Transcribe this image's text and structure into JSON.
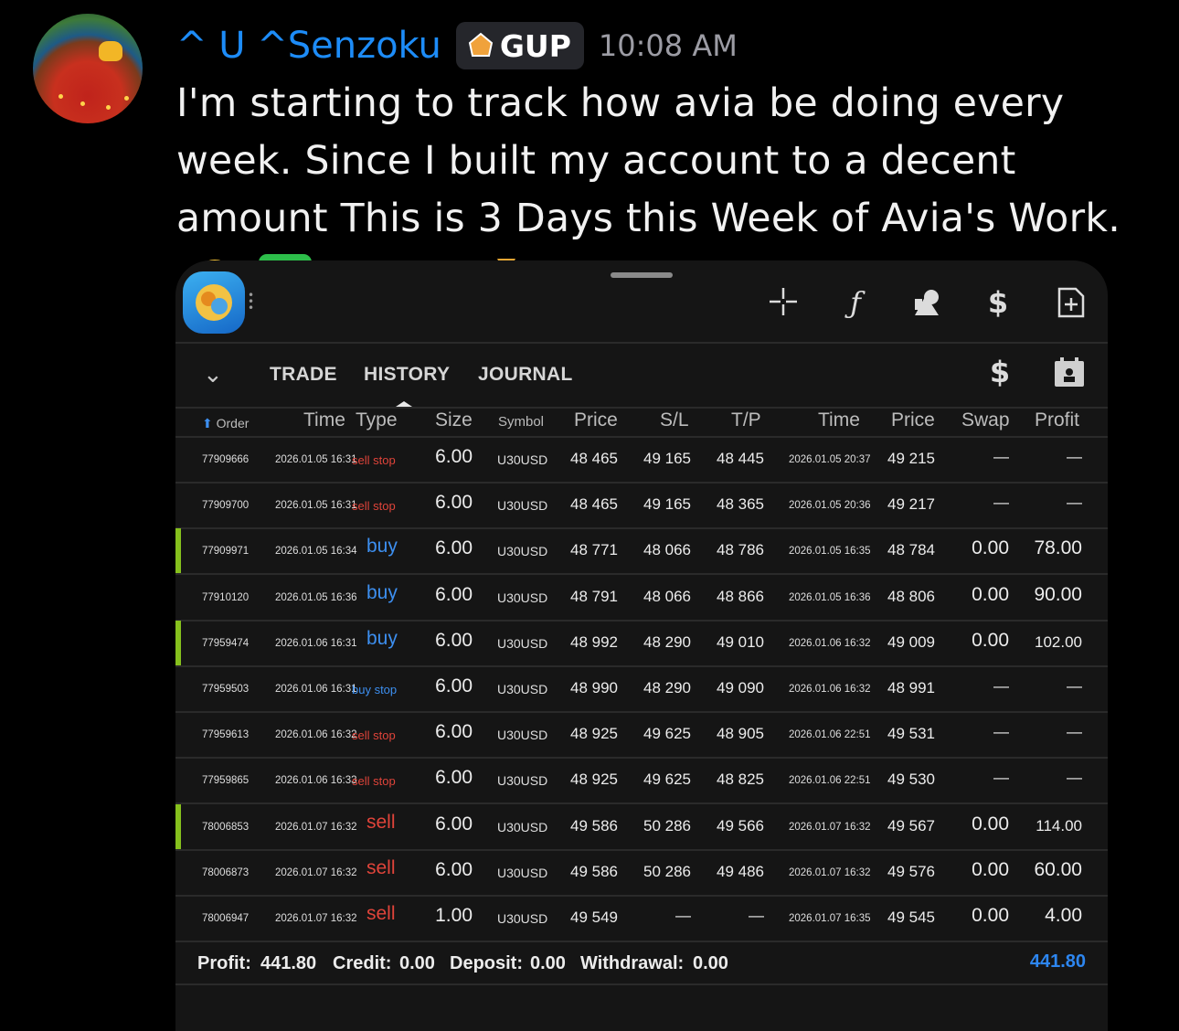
{
  "post": {
    "username": "^ U ^Senzoku",
    "tag": "GUP",
    "timestamp": "10:08 AM",
    "message": "I'm starting to track how avia be doing every week. Since I built my account to a decent amount This is 3 Days this Week of Avia's Work.",
    "emojis": [
      "saluting-face",
      "check-mark-button",
      "hundred-points",
      "dollar-banknote",
      "money-bag"
    ],
    "colors": {
      "username": "#1d8cf8",
      "timestamp": "#9c9ca4"
    }
  },
  "app": {
    "toolbar_icons": [
      "crosshair-icon",
      "function-icon",
      "objects-icon",
      "trade-dollar-icon",
      "new-document-icon"
    ],
    "tabs": [
      "TRADE",
      "HISTORY",
      "JOURNAL"
    ],
    "active_tab": "HISTORY",
    "columns": {
      "order": "Order",
      "time": "Time",
      "type": "Type",
      "size": "Size",
      "symbol": "Symbol",
      "price": "Price",
      "sl": "S/L",
      "tp": "T/P",
      "close_time": "Time",
      "close_price": "Price",
      "swap": "Swap",
      "profit": "Profit"
    },
    "rows": [
      {
        "order": "77909666",
        "time": "2026.01.05 16:31",
        "type": "sell stop",
        "size": "6.00",
        "symbol": "U30USD",
        "price": "48 465",
        "sl": "49 165",
        "tp": "48 445",
        "close_time": "2026.01.05 20:37",
        "close_price": "49 215",
        "swap": "—",
        "profit": "—",
        "marked": false
      },
      {
        "order": "77909700",
        "time": "2026.01.05 16:31",
        "type": "sell stop",
        "size": "6.00",
        "symbol": "U30USD",
        "price": "48 465",
        "sl": "49 165",
        "tp": "48 365",
        "close_time": "2026.01.05 20:36",
        "close_price": "49 217",
        "swap": "—",
        "profit": "—",
        "marked": false
      },
      {
        "order": "77909971",
        "time": "2026.01.05 16:34",
        "type": "buy",
        "size": "6.00",
        "symbol": "U30USD",
        "price": "48 771",
        "sl": "48 066",
        "tp": "48 786",
        "close_time": "2026.01.05 16:35",
        "close_price": "48 784",
        "swap": "0.00",
        "profit": "78.00",
        "marked": true
      },
      {
        "order": "77910120",
        "time": "2026.01.05 16:36",
        "type": "buy",
        "size": "6.00",
        "symbol": "U30USD",
        "price": "48 791",
        "sl": "48 066",
        "tp": "48 866",
        "close_time": "2026.01.05 16:36",
        "close_price": "48 806",
        "swap": "0.00",
        "profit": "90.00",
        "marked": false
      },
      {
        "order": "77959474",
        "time": "2026.01.06 16:31",
        "type": "buy",
        "size": "6.00",
        "symbol": "U30USD",
        "price": "48 992",
        "sl": "48 290",
        "tp": "49 010",
        "close_time": "2026.01.06 16:32",
        "close_price": "49 009",
        "swap": "0.00",
        "profit": "102.00",
        "marked": true
      },
      {
        "order": "77959503",
        "time": "2026.01.06 16:31",
        "type": "buy stop",
        "size": "6.00",
        "symbol": "U30USD",
        "price": "48 990",
        "sl": "48 290",
        "tp": "49 090",
        "close_time": "2026.01.06 16:32",
        "close_price": "48 991",
        "swap": "—",
        "profit": "—",
        "marked": false
      },
      {
        "order": "77959613",
        "time": "2026.01.06 16:32",
        "type": "sell stop",
        "size": "6.00",
        "symbol": "U30USD",
        "price": "48 925",
        "sl": "49 625",
        "tp": "48 905",
        "close_time": "2026.01.06 22:51",
        "close_price": "49 531",
        "swap": "—",
        "profit": "—",
        "marked": false
      },
      {
        "order": "77959865",
        "time": "2026.01.06 16:33",
        "type": "sell stop",
        "size": "6.00",
        "symbol": "U30USD",
        "price": "48 925",
        "sl": "49 625",
        "tp": "48 825",
        "close_time": "2026.01.06 22:51",
        "close_price": "49 530",
        "swap": "—",
        "profit": "—",
        "marked": false
      },
      {
        "order": "78006853",
        "time": "2026.01.07 16:32",
        "type": "sell",
        "size": "6.00",
        "symbol": "U30USD",
        "price": "49 586",
        "sl": "50 286",
        "tp": "49 566",
        "close_time": "2026.01.07 16:32",
        "close_price": "49 567",
        "swap": "0.00",
        "profit": "114.00",
        "marked": true
      },
      {
        "order": "78006873",
        "time": "2026.01.07 16:32",
        "type": "sell",
        "size": "6.00",
        "symbol": "U30USD",
        "price": "49 586",
        "sl": "50 286",
        "tp": "49 486",
        "close_time": "2026.01.07 16:32",
        "close_price": "49 576",
        "swap": "0.00",
        "profit": "60.00",
        "marked": false
      },
      {
        "order": "78006947",
        "time": "2026.01.07 16:32",
        "type": "sell",
        "size": "1.00",
        "symbol": "U30USD",
        "price": "49 549",
        "sl": "—",
        "tp": "—",
        "close_time": "2026.01.07 16:35",
        "close_price": "49 545",
        "swap": "0.00",
        "profit": "4.00",
        "marked": false
      }
    ],
    "footer": {
      "profit_label": "Profit:",
      "profit": "441.80",
      "credit_label": "Credit:",
      "credit": "0.00",
      "deposit_label": "Deposit:",
      "deposit": "0.00",
      "withdrawal_label": "Withdrawal:",
      "withdrawal": "0.00",
      "total": "441.80"
    },
    "colors": {
      "buy": "#3d8ff0",
      "sell": "#e0443a",
      "marker": "#86c11d",
      "total": "#2d86f0"
    }
  }
}
